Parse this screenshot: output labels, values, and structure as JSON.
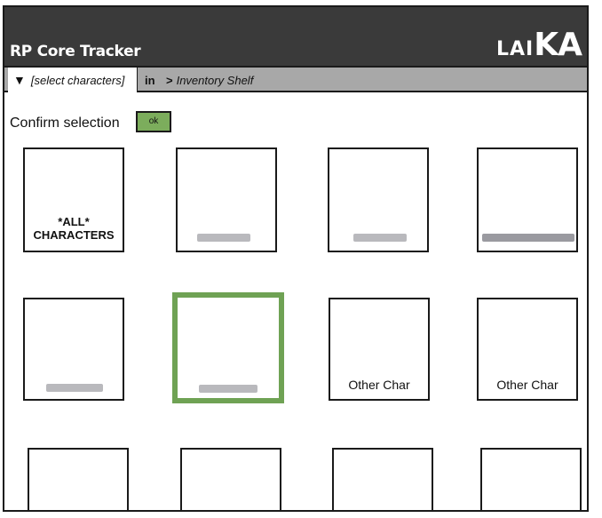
{
  "header": {
    "title": "RP Core Tracker",
    "logo_small": "LAI",
    "logo_big": "KA"
  },
  "toolbar": {
    "selector_icon": "triangle-down-icon",
    "selector_label": "[select characters]",
    "in_label": "in",
    "crumb_arrow": ">",
    "crumb_label": "Inventory Shelf"
  },
  "confirm": {
    "label": "Confirm selection",
    "ok_label": "ok"
  },
  "cards": [
    {
      "label_line1": "*ALL*",
      "label_line2": "CHARACTERS",
      "selected": false
    },
    {
      "label": "",
      "blurred": true,
      "selected": false
    },
    {
      "label": "",
      "blurred": true,
      "selected": false
    },
    {
      "label": "",
      "blurred": true,
      "selected": false
    },
    {
      "label": "",
      "blurred": true,
      "selected": false
    },
    {
      "label": "",
      "blurred": true,
      "selected": true
    },
    {
      "label": "Other Char",
      "selected": false
    },
    {
      "label": "Other Char",
      "selected": false
    }
  ],
  "colors": {
    "header_bg": "#3a3a3a",
    "tab_bg": "#a8a8a8",
    "ok_bg": "#7cad5c",
    "selected_border": "#6fa254"
  }
}
